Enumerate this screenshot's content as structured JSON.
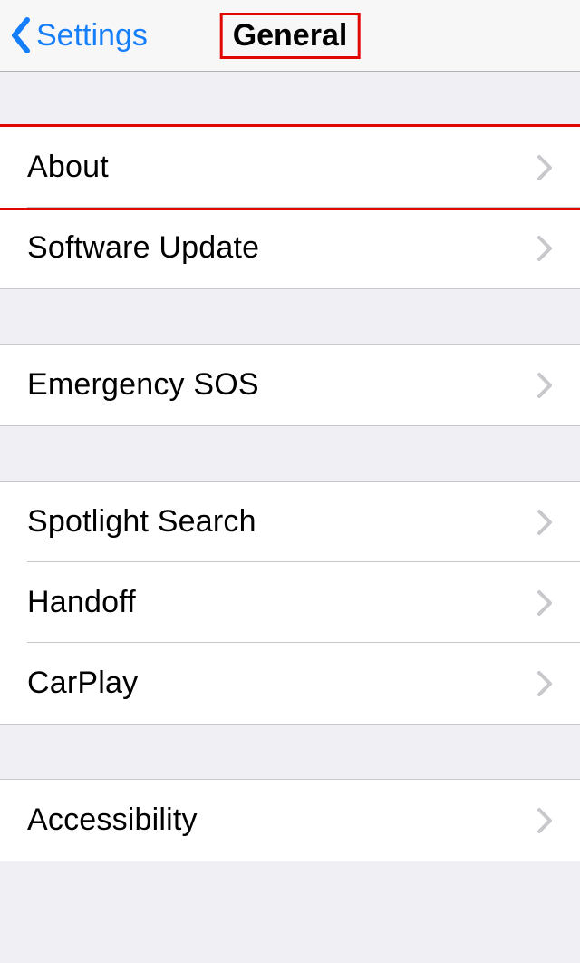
{
  "nav": {
    "back_label": "Settings",
    "title": "General"
  },
  "groups": [
    {
      "items": [
        {
          "id": "about",
          "label": "About",
          "highlight": true
        },
        {
          "id": "software-update",
          "label": "Software Update"
        }
      ]
    },
    {
      "items": [
        {
          "id": "emergency-sos",
          "label": "Emergency SOS"
        }
      ]
    },
    {
      "items": [
        {
          "id": "spotlight-search",
          "label": "Spotlight Search"
        },
        {
          "id": "handoff",
          "label": "Handoff"
        },
        {
          "id": "carplay",
          "label": "CarPlay"
        }
      ]
    },
    {
      "items": [
        {
          "id": "accessibility",
          "label": "Accessibility"
        }
      ]
    }
  ]
}
